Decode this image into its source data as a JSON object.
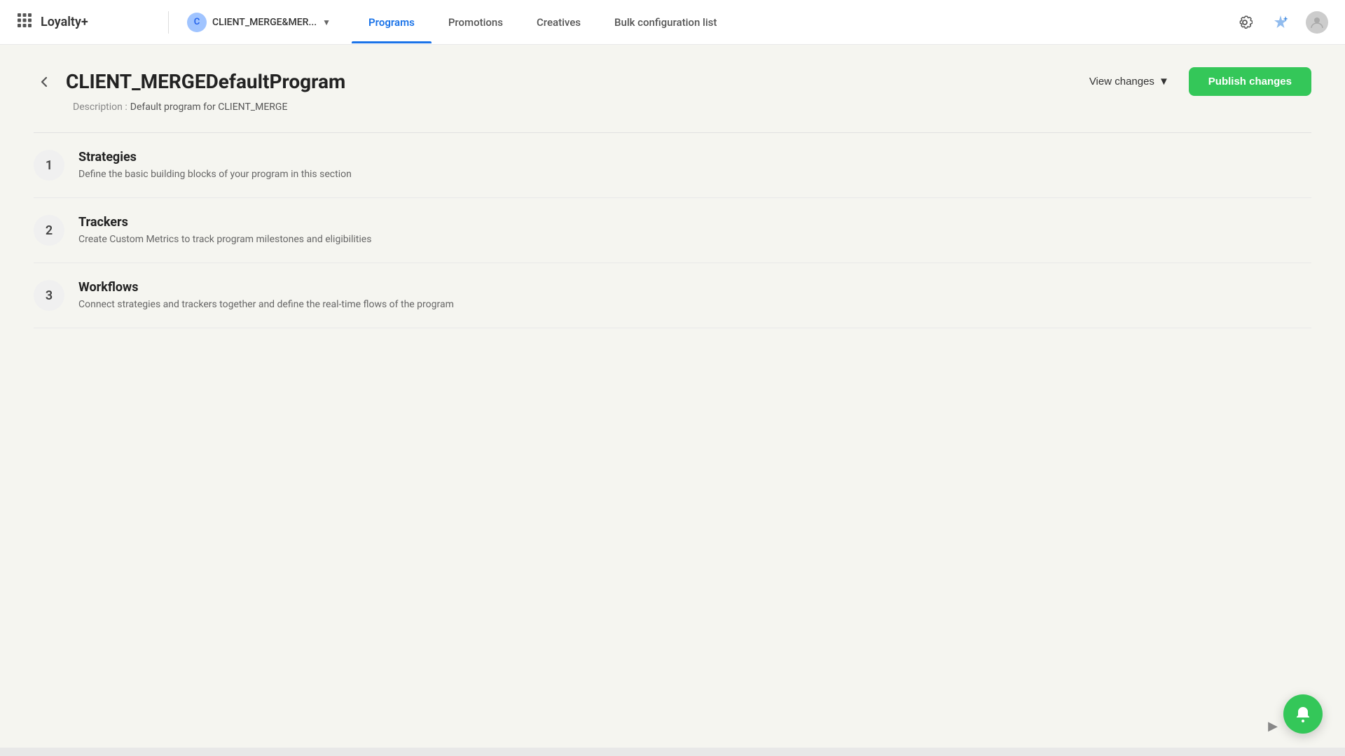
{
  "brand": {
    "name": "Loyalty+",
    "grid_icon": "⊞"
  },
  "client": {
    "avatar_letter": "C",
    "name": "CLIENT_MERGE&MER...",
    "chevron": "▼"
  },
  "nav": {
    "items": [
      {
        "id": "programs",
        "label": "Programs",
        "active": true
      },
      {
        "id": "promotions",
        "label": "Promotions",
        "active": false
      },
      {
        "id": "creatives",
        "label": "Creatives",
        "active": false
      },
      {
        "id": "bulk",
        "label": "Bulk configuration list",
        "active": false
      }
    ]
  },
  "toolbar": {
    "gear_icon": "⚙",
    "sparkle_icon": "✦",
    "user_icon": "👤"
  },
  "page": {
    "back_arrow": "←",
    "title": "CLIENT_MERGEDefaultProgram",
    "description_label": "Description :",
    "description_text": "Default program for CLIENT_MERGE",
    "view_changes_label": "View changes",
    "view_changes_chevron": "▼",
    "publish_label": "Publish changes"
  },
  "sections": [
    {
      "number": "1",
      "title": "Strategies",
      "description": "Define the basic building blocks of your program in this section"
    },
    {
      "number": "2",
      "title": "Trackers",
      "description": "Create Custom Metrics to track program milestones and eligibilities"
    },
    {
      "number": "3",
      "title": "Workflows",
      "description": "Connect strategies and trackers together and define the real-time flows of the program"
    }
  ],
  "notification_fab": {
    "icon": "🔔"
  }
}
